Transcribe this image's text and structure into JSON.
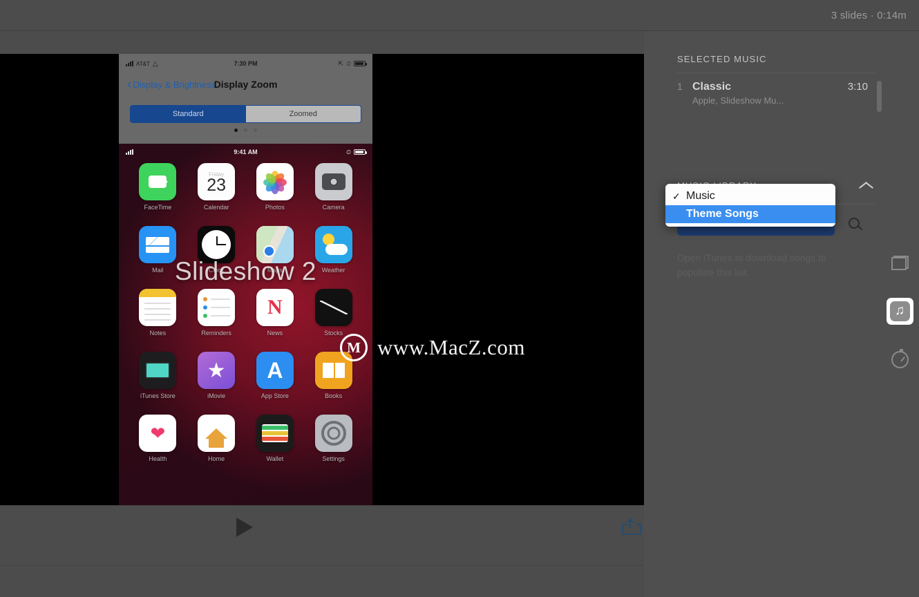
{
  "topbar": {
    "meta": "3 slides · 0:14m"
  },
  "preview": {
    "settings_screen": {
      "status": {
        "carrier": "AT&T",
        "wifi_icon": "wifi-icon",
        "time": "7:30 PM",
        "battery_icon": "battery-icon"
      },
      "back_label": "Display & Brightness",
      "title": "Display Zoom",
      "segments": [
        {
          "label": "Standard",
          "selected": true
        },
        {
          "label": "Zoomed",
          "selected": false
        }
      ],
      "page_dots": 3,
      "active_dot": 0
    },
    "home_screen": {
      "status": {
        "time": "9:41 AM"
      },
      "apps": [
        {
          "name": "FaceTime",
          "icon": "facetime-icon"
        },
        {
          "name": "Calendar",
          "icon": "calendar-icon",
          "month": "Friday",
          "day": "23"
        },
        {
          "name": "Photos",
          "icon": "photos-icon"
        },
        {
          "name": "Camera",
          "icon": "camera-icon"
        },
        {
          "name": "Mail",
          "icon": "mail-icon"
        },
        {
          "name": "Clock",
          "icon": "clock-icon"
        },
        {
          "name": "Maps",
          "icon": "maps-icon"
        },
        {
          "name": "Weather",
          "icon": "weather-icon"
        },
        {
          "name": "Notes",
          "icon": "notes-icon"
        },
        {
          "name": "Reminders",
          "icon": "reminders-icon"
        },
        {
          "name": "News",
          "icon": "news-icon"
        },
        {
          "name": "Stocks",
          "icon": "stocks-icon"
        },
        {
          "name": "iTunes Store",
          "icon": "itunes-icon"
        },
        {
          "name": "iMovie",
          "icon": "imovie-icon"
        },
        {
          "name": "App Store",
          "icon": "appstore-icon"
        },
        {
          "name": "Books",
          "icon": "books-icon"
        },
        {
          "name": "Health",
          "icon": "health-icon"
        },
        {
          "name": "Home",
          "icon": "home-icon"
        },
        {
          "name": "Wallet",
          "icon": "wallet-icon"
        },
        {
          "name": "Settings",
          "icon": "settings-icon"
        }
      ]
    },
    "slide_title": "Slideshow 2"
  },
  "watermark": {
    "logo": "M",
    "text": "www.MacZ.com"
  },
  "transport": {
    "play_label": "play-icon",
    "export_label": "share-export-icon"
  },
  "sidebar": {
    "selected_music": {
      "title": "SELECTED MUSIC",
      "tracks": [
        {
          "num": "1",
          "name": "Classic",
          "artist": "Apple, Slideshow Mu...",
          "duration": "3:10"
        }
      ]
    },
    "music_library": {
      "title": "MUSIC LIBRARY",
      "collapse_icon": "chevron-up-icon",
      "search_icon": "search-icon",
      "empty_message": "Open iTunes to download songs to populate this list.",
      "dropdown": {
        "open": true,
        "options": [
          {
            "label": "Music",
            "checked": true,
            "highlighted": false
          },
          {
            "label": "Theme Songs",
            "checked": false,
            "highlighted": true
          }
        ]
      }
    },
    "rail": [
      {
        "name": "slides-icon",
        "active": false
      },
      {
        "name": "music-icon",
        "active": true,
        "glyph": "♫"
      },
      {
        "name": "timer-icon",
        "active": false
      }
    ]
  },
  "colors": {
    "window_bg": "#4c4c4c",
    "sidebar_bg": "#4f4f4f",
    "accent_blue": "#3a8ef0",
    "menu_bg": "#fdfdfd",
    "popup_button": "#1c3a6e"
  }
}
